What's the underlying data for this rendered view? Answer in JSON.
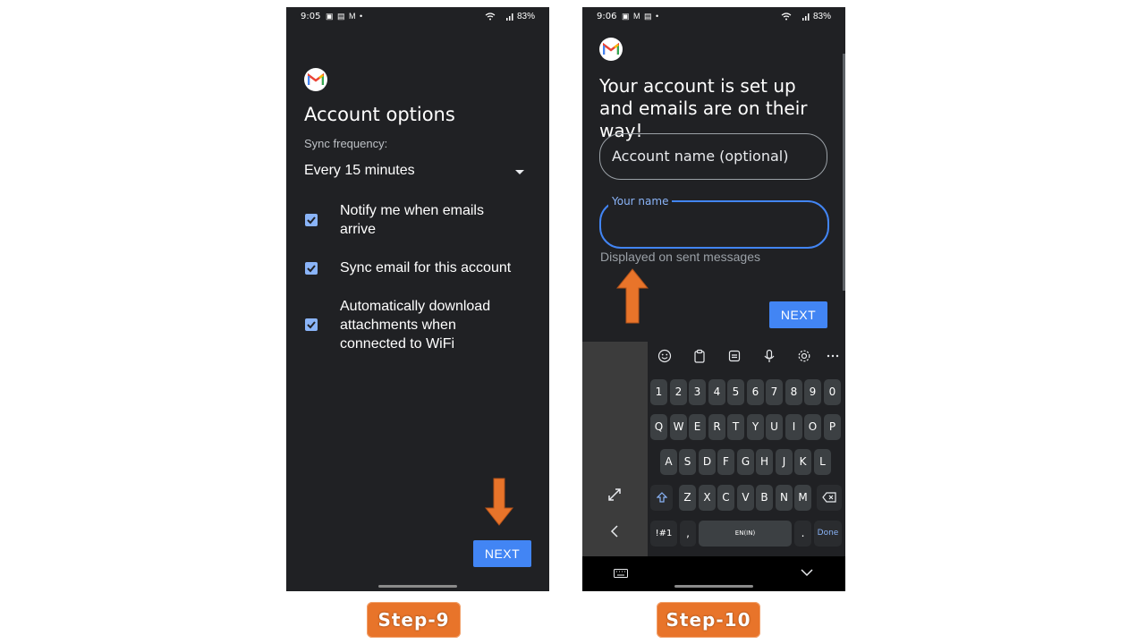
{
  "step9": {
    "status": {
      "time": "9:05",
      "left_icons": "▣ ▤ M •",
      "battery": "83%"
    },
    "title": "Account options",
    "sync_label": "Sync frequency:",
    "sync_value": "Every 15 minutes",
    "options": [
      {
        "label": "Notify me when emails arrive",
        "checked": true
      },
      {
        "label": "Sync email for this account",
        "checked": true
      },
      {
        "label": "Automatically download attachments when connected to WiFi",
        "checked": true
      }
    ],
    "next_label": "NEXT",
    "badge": "Step-9"
  },
  "step10": {
    "status": {
      "time": "9:06",
      "left_icons": "▣ M ▤ •",
      "battery": "83%"
    },
    "title": "Your account is set up and emails are on their way!",
    "account_name_placeholder": "Account name (optional)",
    "your_name_label": "Your name",
    "helper_text": "Displayed on sent messages",
    "next_label": "NEXT",
    "badge": "Step-10",
    "keyboard": {
      "toolbar": [
        "emoji-icon",
        "clipboard-icon",
        "sticker-icon",
        "mic-icon",
        "gear-icon",
        "more-icon"
      ],
      "row1": [
        "1",
        "2",
        "3",
        "4",
        "5",
        "6",
        "7",
        "8",
        "9",
        "0"
      ],
      "row2": [
        "Q",
        "W",
        "E",
        "R",
        "T",
        "Y",
        "U",
        "I",
        "O",
        "P"
      ],
      "row3": [
        "A",
        "S",
        "D",
        "F",
        "G",
        "H",
        "J",
        "K",
        "L"
      ],
      "row4": [
        "Z",
        "X",
        "C",
        "V",
        "B",
        "N",
        "M"
      ],
      "symbols_label": "!#1",
      "comma_label": ",",
      "space_label": "EN(IN)",
      "period_label": ".",
      "done_label": "Done"
    }
  },
  "colors": {
    "accent": "#4285f4",
    "badge": "#e8742a",
    "arrow": "#e8742a"
  }
}
